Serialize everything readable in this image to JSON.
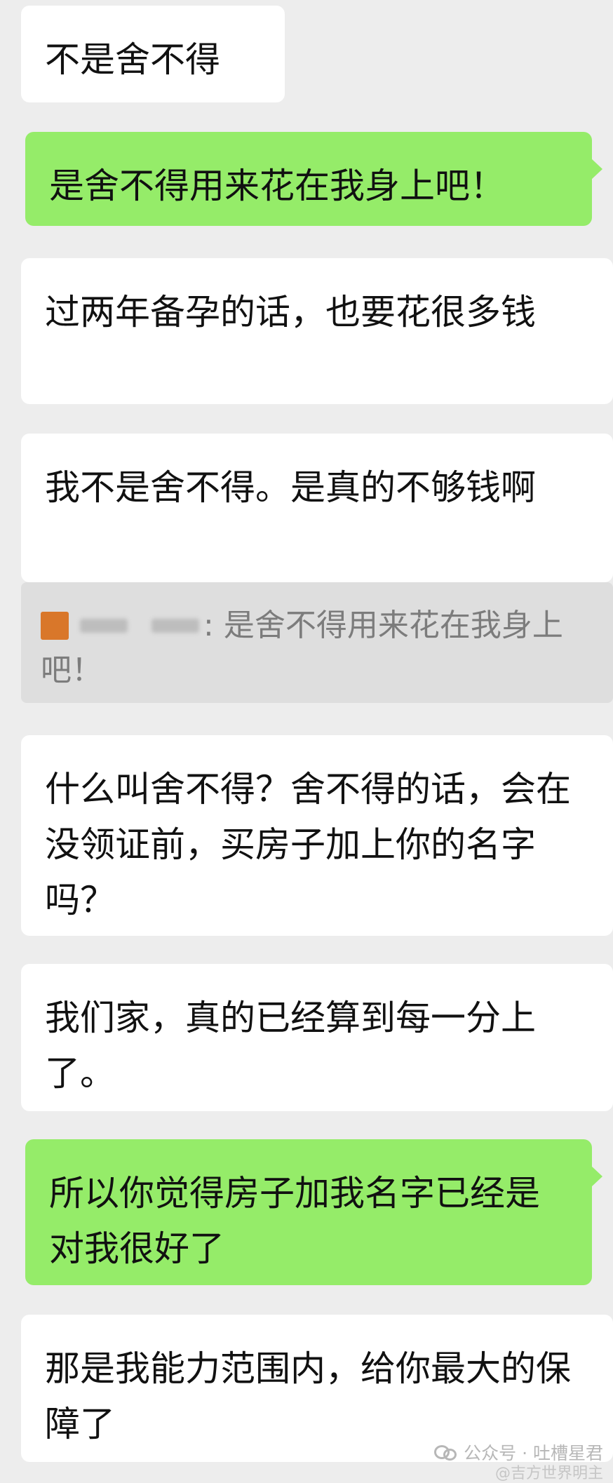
{
  "messages": [
    {
      "side": "in",
      "text": "不是舍不得"
    },
    {
      "side": "out",
      "text": "是舍不得用来花在我身上吧！"
    },
    {
      "side": "in",
      "text": "过两年备孕的话，也要花很多钱"
    },
    {
      "side": "in",
      "text": "我不是舍不得。是真的不够钱啊"
    },
    {
      "side": "in",
      "text": "什么叫舍不得？舍不得的话，会在没领证前，买房子加上你的名字吗？"
    },
    {
      "side": "in",
      "text": "我们家，真的已经算到每一分上了。"
    },
    {
      "side": "out",
      "text": "所以你觉得房子加我名字已经是对我很好了"
    },
    {
      "side": "in",
      "text": "那是我能力范围内，给你最大的保障了"
    }
  ],
  "quote": {
    "separator": ":",
    "text": "是舍不得用来花在我身上吧！"
  },
  "watermark": {
    "text": "公众号 · 吐槽星君",
    "source": "@吉方世界明主"
  }
}
